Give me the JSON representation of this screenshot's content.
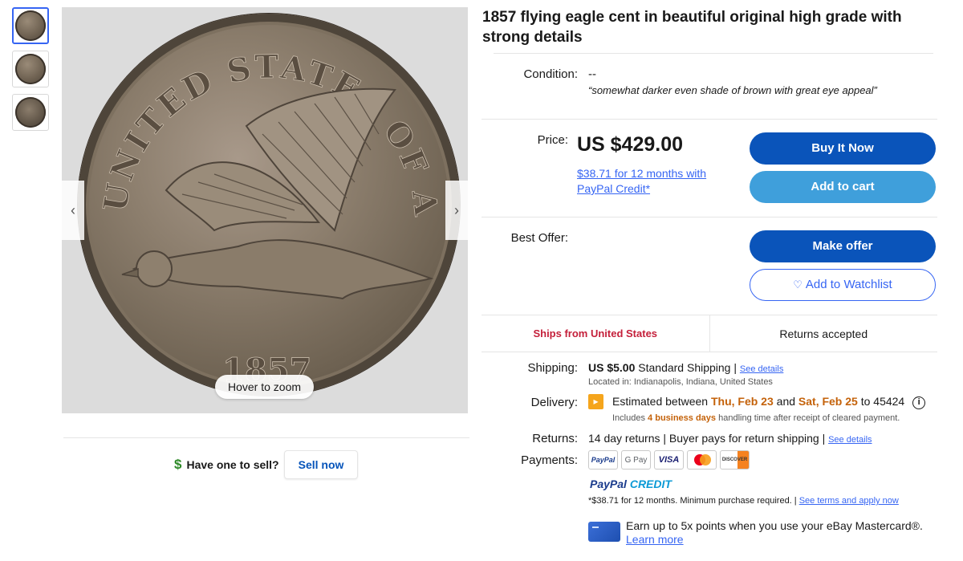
{
  "gallery": {
    "zoom_hint": "Hover to zoom",
    "prev_arrow": "‹",
    "next_arrow": "›",
    "coin_top_text": "UNITED STATES OF AMERICA",
    "coin_year": "1857"
  },
  "sell": {
    "icon": "$",
    "prompt": "Have one to sell?",
    "button": "Sell now"
  },
  "listing": {
    "title": "1857 flying eagle cent in beautiful original high grade with strong details",
    "condition_label": "Condition:",
    "condition_value": "--",
    "condition_quote": "“somewhat darker even shade of brown with great eye appeal”",
    "price_label": "Price:",
    "price": "US $429.00",
    "credit_offer": "$38.71 for 12 months with PayPal Credit*",
    "buy_now": "Buy It Now",
    "add_to_cart": "Add to cart",
    "best_offer_label": "Best Offer:",
    "make_offer": "Make offer",
    "heart_icon": "♡",
    "add_to_watchlist": "Add to Watchlist"
  },
  "badges": {
    "ships_from": "Ships from United States",
    "returns": "Returns accepted"
  },
  "shipping": {
    "label": "Shipping:",
    "cost": "US $5.00",
    "method": "Standard Shipping |",
    "see_details": "See details",
    "location": "Located in: Indianapolis, Indiana, United States"
  },
  "delivery": {
    "label": "Delivery:",
    "truck_icon": "▸",
    "prefix": "Estimated between",
    "start": "Thu, Feb 23",
    "and": "and",
    "end": "Sat, Feb 25",
    "to": "to 45424",
    "info_icon": "i",
    "note_prefix": "Includes",
    "note_days": "4 business days",
    "note_suffix": "handling time after receipt of cleared payment."
  },
  "returns": {
    "label": "Returns:",
    "value": "14 day returns | Buyer pays for return shipping |",
    "see_details": "See details"
  },
  "payments": {
    "label": "Payments:",
    "methods": [
      "PayPal",
      "G Pay",
      "VISA",
      "",
      "DISCOVER"
    ],
    "paypal_credit_a": "PayPal",
    "paypal_credit_b": "CREDIT",
    "terms_text": "*$38.71 for 12 months. Minimum purchase required. |",
    "terms_link": "See terms and apply now",
    "mastercard_promo": "Earn up to 5x points when you use your eBay Mastercard®.",
    "learn_more": "Learn more"
  }
}
